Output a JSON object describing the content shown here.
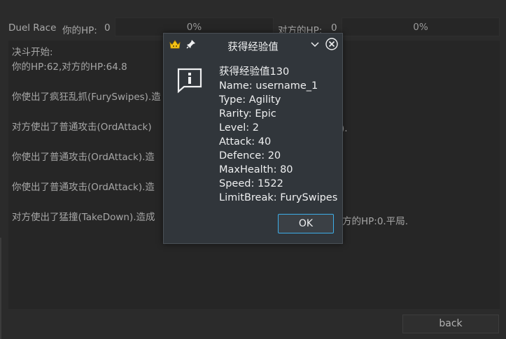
{
  "status": {
    "title": "Duel Race",
    "my_hp_label": "你的HP:",
    "my_hp_value": "0",
    "my_hp_percent": "0%",
    "opp_hp_label": "对方的HP:",
    "opp_hp_value": "0",
    "opp_hp_percent": "0%"
  },
  "log": {
    "lines": [
      "决斗开始:",
      "你的HP:62,对方的HP:64.8",
      "",
      "你使出了疯狂乱抓(FurySwipes).造",
      "",
      "对方使出了普通攻击(OrdAttack)",
      "",
      "你使出了普通攻击(OrdAttack).造",
      "",
      "你使出了普通攻击(OrdAttack).造",
      "",
      "对方使出了猛撞(TakeDown).造成"
    ],
    "right_fragments": {
      "line5": ").",
      "line11": "方的HP:0.平局."
    }
  },
  "back_button": "back",
  "dialog": {
    "title": "获得经验值",
    "heading": "获得经验值130",
    "rows": [
      "Name: username_1",
      "Type: Agility",
      "Rarity: Epic",
      "Level: 2",
      "Attack: 40",
      "Defence: 20",
      "MaxHealth: 80",
      "Speed: 1522",
      "LimitBreak: FurySwipes"
    ],
    "ok_label": "OK"
  },
  "colors": {
    "accent": "#3daee9",
    "dialog_bg": "#31363b",
    "window_bg": "#2b2b2b"
  },
  "icons": [
    "app-crown-icon",
    "pin-icon",
    "chevron-down-icon",
    "close-icon",
    "info-icon"
  ]
}
